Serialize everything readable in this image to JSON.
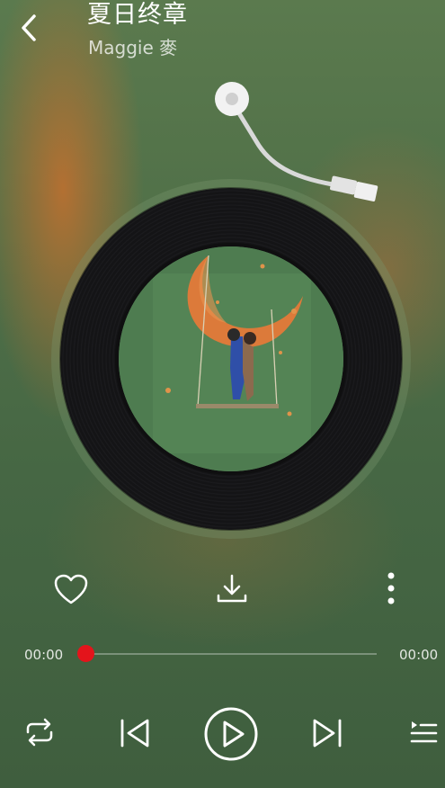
{
  "header": {
    "title": "夏日终章",
    "artist": "Maggie 麥"
  },
  "icons": {
    "back": "back-chevron-icon",
    "like": "heart-icon",
    "download": "download-icon",
    "more": "more-vertical-icon",
    "repeat": "repeat-icon",
    "previous": "skip-previous-icon",
    "play": "play-icon",
    "next": "skip-next-icon",
    "playlist": "playlist-icon"
  },
  "player": {
    "current_time": "00:00",
    "total_time": "00:00",
    "progress": 0
  },
  "colors": {
    "accent": "#e4141b",
    "icon": "#ffffff"
  }
}
